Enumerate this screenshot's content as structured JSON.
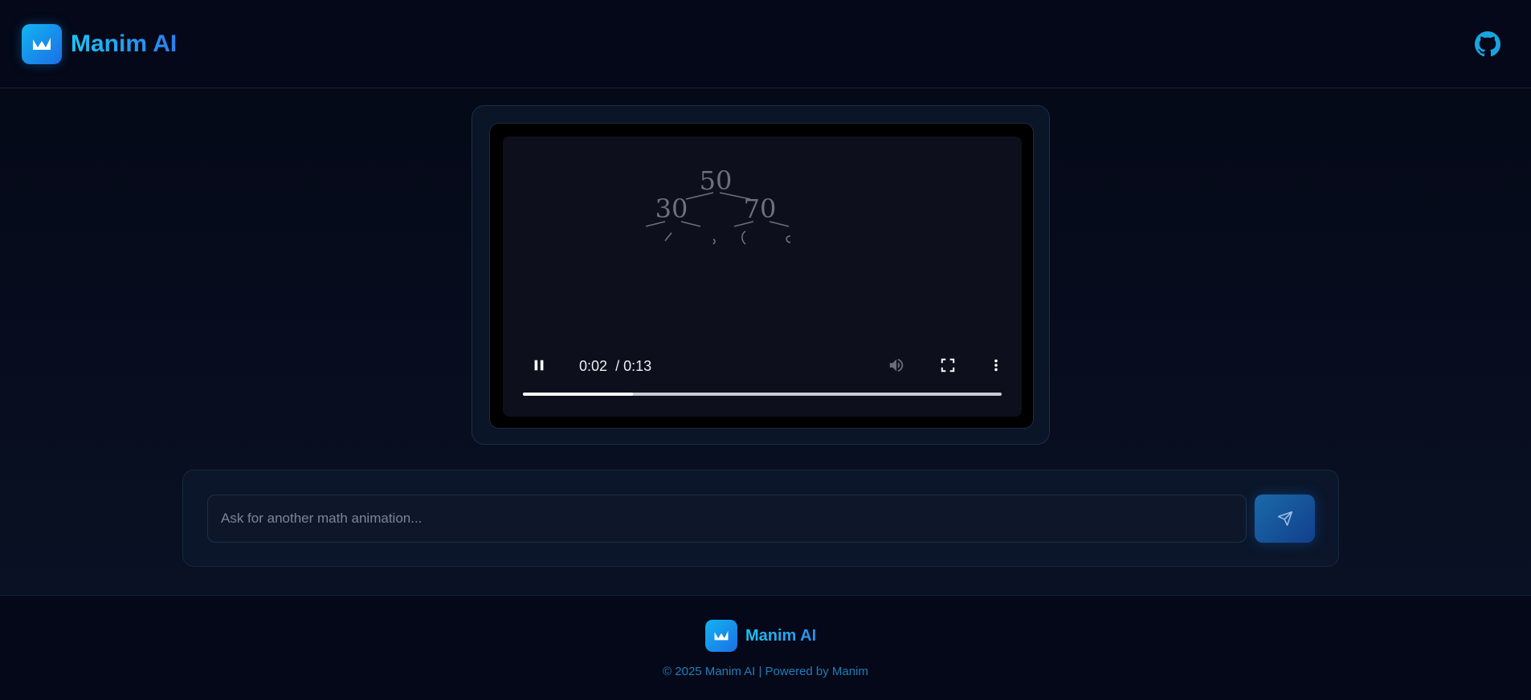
{
  "header": {
    "brand_name": "Manim AI",
    "logo_icon": "logo-icon",
    "github_icon": "github-icon"
  },
  "video": {
    "tree_nodes": [
      "50",
      "30",
      "70"
    ],
    "current_time": "0:02",
    "duration": "/ 0:13",
    "progress_fraction": 0.23,
    "controls": [
      "pause-icon",
      "volume-icon",
      "fullscreen-icon",
      "more-options-icon"
    ]
  },
  "prompt": {
    "placeholder": "Ask for another math animation...",
    "value": "",
    "send_icon": "send-icon"
  },
  "footer": {
    "brand_name": "Manim AI",
    "copyright": "© 2025 Manim AI | Powered by Manim"
  },
  "colors": {
    "background": "#060b1a",
    "accent": "#1fa8f0",
    "card_border": "#16304a"
  }
}
